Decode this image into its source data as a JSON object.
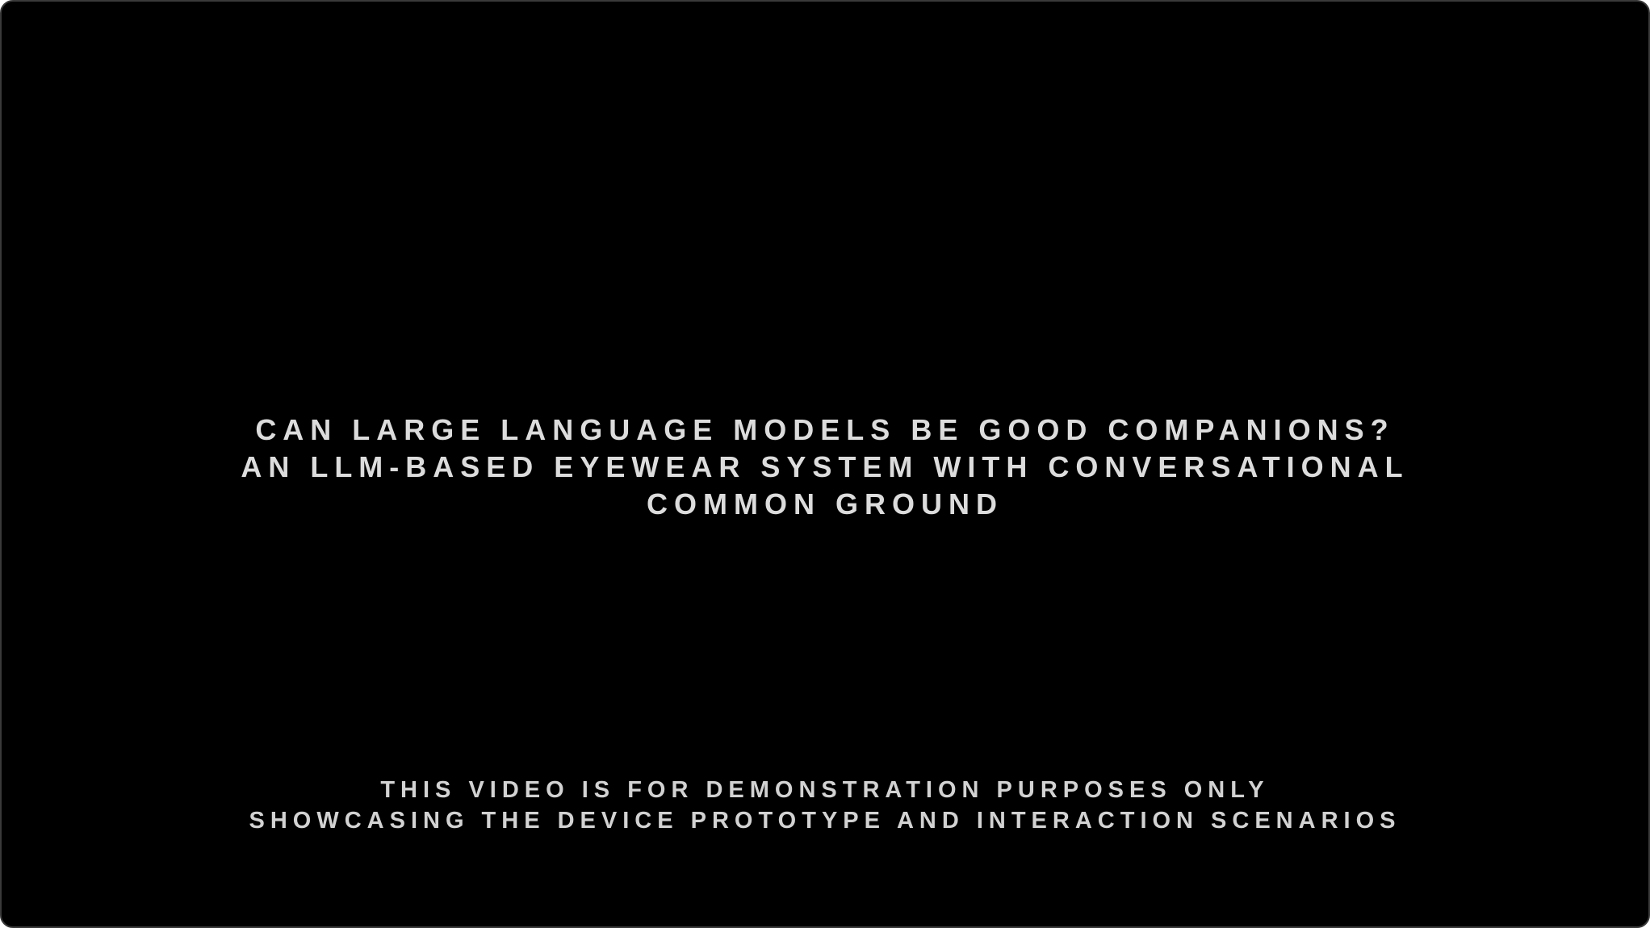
{
  "video": {
    "title_lines": [
      "CAN LARGE LANGUAGE MODELS BE GOOD COMPANIONS?",
      "AN LLM-BASED EYEWEAR SYSTEM WITH CONVERSATIONAL",
      "COMMON GROUND"
    ],
    "disclaimer_lines": [
      "THIS VIDEO IS FOR DEMONSTRATION PURPOSES ONLY",
      "SHOWCASING THE DEVICE PROTOTYPE AND INTERACTION SCENARIOS"
    ]
  },
  "colors": {
    "background": "#000000",
    "text": "#dcdcdc"
  }
}
